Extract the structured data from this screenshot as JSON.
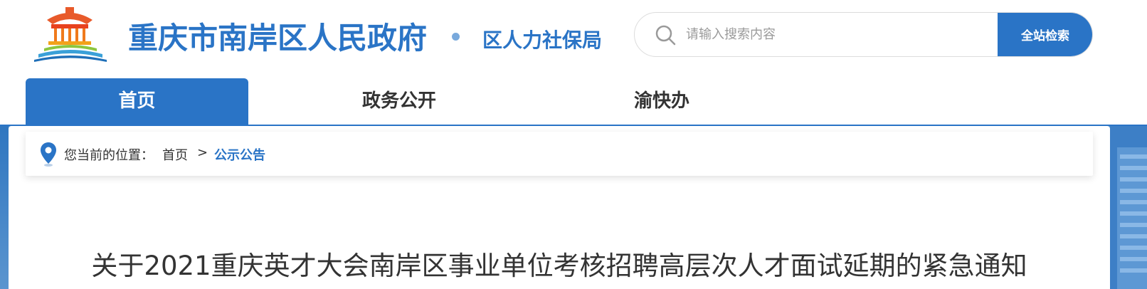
{
  "header": {
    "site_name": "重庆市南岸区人民政府",
    "sub_name": "区人力社保局",
    "logo_icon": "government-building-logo-icon"
  },
  "search": {
    "placeholder": "请输入搜索内容",
    "value": "",
    "button_label": "全站检索",
    "icon": "search-icon"
  },
  "nav": {
    "items": [
      {
        "label": "首页",
        "active": true
      },
      {
        "label": "政务公开",
        "active": false
      },
      {
        "label": "渝快办",
        "active": false
      }
    ]
  },
  "breadcrumb": {
    "prefix": "您当前的位置：",
    "home": "首页",
    "separator": ">",
    "current": "公示公告",
    "icon": "location-pin-icon"
  },
  "article": {
    "title": "关于2021重庆英才大会南岸区事业单位考核招聘高层次人才面试延期的紧急通知"
  },
  "colors": {
    "brand_blue": "#2a74c6",
    "text": "#333333",
    "placeholder": "#9a9a9a"
  }
}
